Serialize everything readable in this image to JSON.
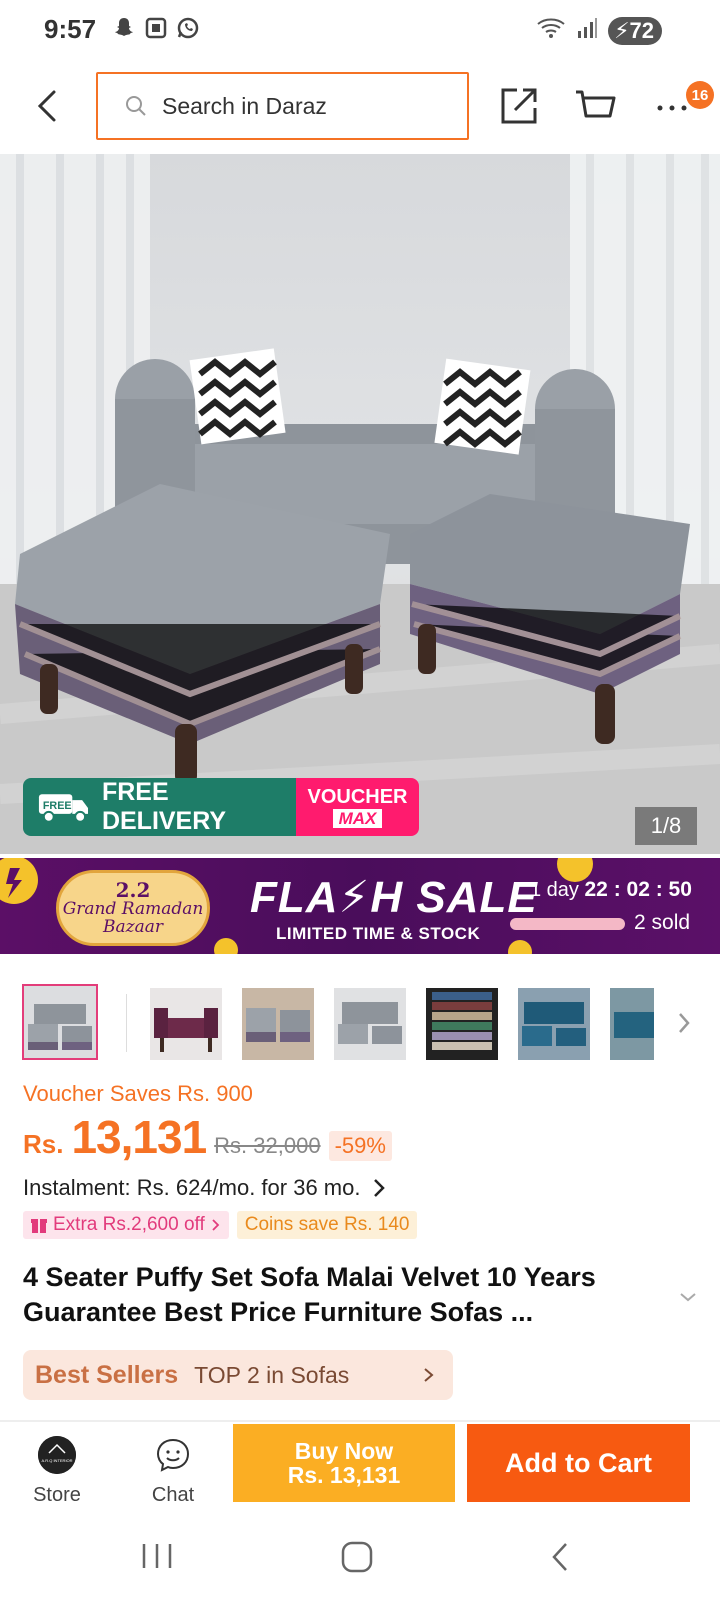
{
  "status_bar": {
    "time": "9:57",
    "battery": "72",
    "icons": [
      "snapchat-icon",
      "screenshot-icon",
      "whatsapp-icon",
      "wifi-icon",
      "signal-icon"
    ]
  },
  "header": {
    "search_placeholder": "Search in Daraz",
    "more_badge": "16",
    "accent_color": "#f57224"
  },
  "product_image": {
    "counter": "1/8",
    "badges": {
      "free_delivery": "FREE DELIVERY",
      "free_truck_text": "FREE",
      "voucher_line1": "VOUCHER",
      "voucher_line2": "MAX"
    }
  },
  "flash_sale": {
    "campaign_number": "2.2",
    "campaign_line1": "Grand Ramadan",
    "campaign_line2": "Bazaar",
    "title": "FLA⚡H SALE",
    "subtitle": "LIMITED TIME & STOCK",
    "countdown_prefix": "1 day",
    "countdown_time": "22 : 02 : 50",
    "sold": "2 sold",
    "sold_fraction": 1.0
  },
  "thumbnails": {
    "count": 8,
    "active_index": 0
  },
  "pricing": {
    "voucher_saves": "Voucher Saves Rs. 900",
    "currency": "Rs.",
    "current_price": "13,131",
    "original_price": "Rs. 32,000",
    "discount": "-59%",
    "instalment": "Instalment: Rs. 624/mo. for 36 mo.",
    "extra_off": "Extra Rs.2,600 off",
    "coins_save": "Coins save Rs. 140"
  },
  "product": {
    "title": "4 Seater Puffy Set Sofa Malai Velvet 10 Years Guarantee Best Price Furniture Sofas ..."
  },
  "best_sellers": {
    "label": "Best Sellers",
    "rank": "TOP 2 in Sofas"
  },
  "bottom_bar": {
    "store_label": "Store",
    "store_logo_text": "A.R.Q INTERIOR",
    "chat_label": "Chat",
    "buy_now_line1": "Buy Now",
    "buy_now_line2": "Rs. 13,131",
    "add_to_cart": "Add to Cart",
    "buy_color": "#fbae23",
    "cart_color": "#f75a11"
  }
}
